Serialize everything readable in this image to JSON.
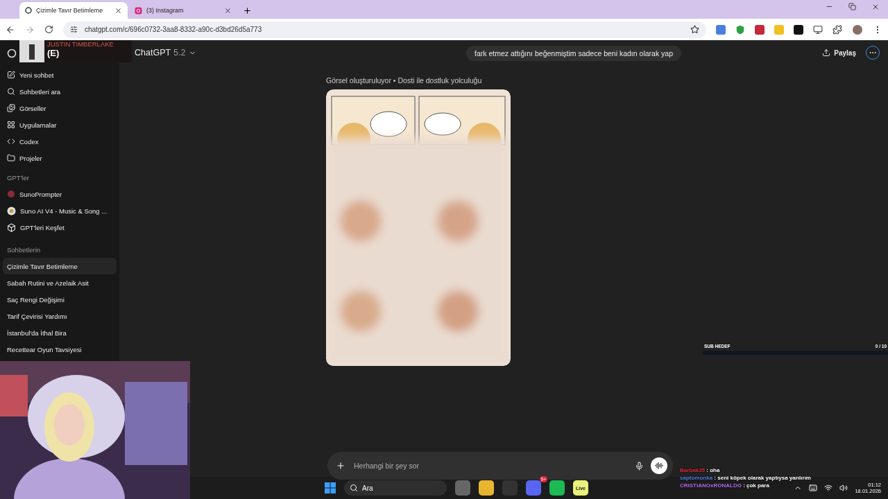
{
  "browser": {
    "tabs": [
      {
        "title": "Çizimle Tavır Betimleme",
        "selected": true,
        "kind": "chatgpt"
      },
      {
        "title": "(3) Instagram",
        "selected": false,
        "kind": "instagram"
      }
    ],
    "url": "chatgpt.com/c/696c0732-3aa8-8332-a90c-d3bd26d5a773"
  },
  "sidebar": {
    "nav": [
      "Yeni sohbet",
      "Sohbetleri ara",
      "Görseller",
      "Uygulamalar",
      "Codex",
      "Projeler"
    ],
    "gpts_heading": "GPT'ler",
    "gpts": [
      {
        "label": "SunoPrompter",
        "kind": "dot"
      },
      {
        "label": "Suno AI V4 - Music & Song ...",
        "kind": "logo"
      },
      {
        "label": "GPT'leri Keşfet",
        "kind": "cube"
      }
    ],
    "chats_heading": "Sohbetlerin",
    "chats": [
      {
        "label": "Çizimle Tavır Betimleme",
        "selected": true
      },
      {
        "label": "Sabah Rutini ve Azelaik Asit",
        "selected": false
      },
      {
        "label": "Saç Rengi Değişimi",
        "selected": false
      },
      {
        "label": "Tarif Çevirisi Yardımı",
        "selected": false
      },
      {
        "label": "İstanbul'da İthal Bira",
        "selected": false
      },
      {
        "label": "Recettear Oyun Tavsiyesi",
        "selected": false
      }
    ]
  },
  "header": {
    "model_name": "ChatGPT",
    "model_version": "5.2",
    "share": "Paylaş"
  },
  "conversation": {
    "user_message": "fark etmez attığını beğenmiştim sadece beni kadın olarak yap",
    "image_caption": "Görsel oluşturuluyor • Dosti ile dostluk yolculuğu"
  },
  "composer": {
    "placeholder": "Herhangi bir şey sor"
  },
  "music_overlay": {
    "artist": "JUSTIN TIMBERLAKE",
    "title": "(E)"
  },
  "sub_goal": {
    "label": "SUB HEDEF",
    "count": "0",
    "total": "/ 10",
    "level": 0
  },
  "chat": [
    {
      "user": "Barbak35",
      "color": "#e0263c",
      "message": ": oha"
    },
    {
      "user": "saptomonka",
      "color": "#4f7fe0",
      "message": ": seni köpek olarak yaptıysa yarılırım"
    },
    {
      "user": "CRISTIANOxRONALDO",
      "color": "#b76cf0",
      "message": ": çok para"
    }
  ],
  "taskbar": {
    "search": "Ara",
    "badge": "9+",
    "app_label": "Live",
    "time": "01:12",
    "date": "18.01.2026"
  }
}
